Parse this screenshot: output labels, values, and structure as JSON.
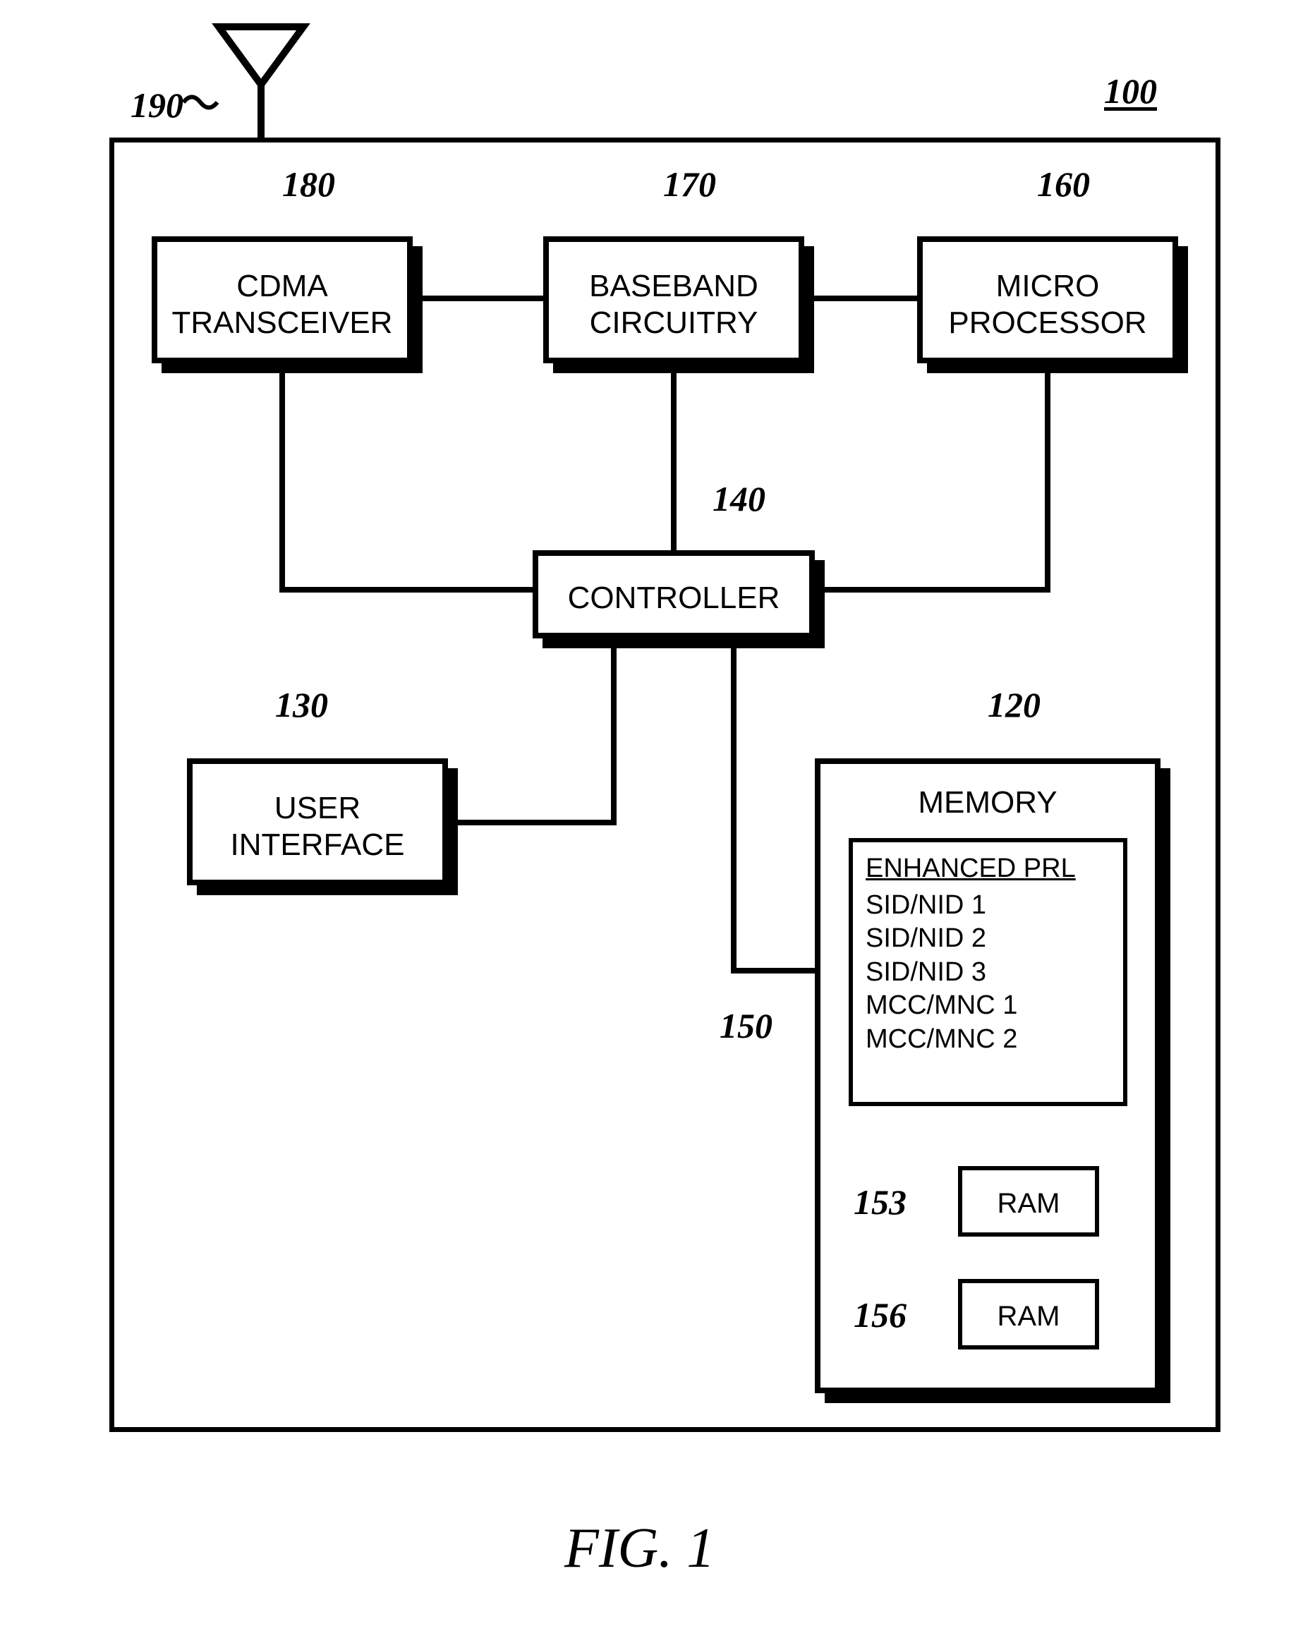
{
  "figure_ref": "100",
  "figure_caption": "FIG. 1",
  "refs": {
    "antenna": "190",
    "transceiver": "180",
    "baseband": "170",
    "micro": "160",
    "controller": "140",
    "ui": "130",
    "memory": "120",
    "prl": "150",
    "ram1": "153",
    "ram2": "156"
  },
  "blocks": {
    "transceiver_l1": "CDMA",
    "transceiver_l2": "TRANSCEIVER",
    "baseband_l1": "BASEBAND",
    "baseband_l2": "CIRCUITRY",
    "micro_l1": "MICRO",
    "micro_l2": "PROCESSOR",
    "controller": "CONTROLLER",
    "ui_l1": "USER",
    "ui_l2": "INTERFACE",
    "memory_title": "MEMORY",
    "prl_title": "ENHANCED PRL",
    "prl_rows": [
      "SID/NID 1",
      "SID/NID 2",
      "SID/NID 3",
      "MCC/MNC 1",
      "MCC/MNC 2"
    ],
    "ram1": "RAM",
    "ram2": "RAM"
  }
}
